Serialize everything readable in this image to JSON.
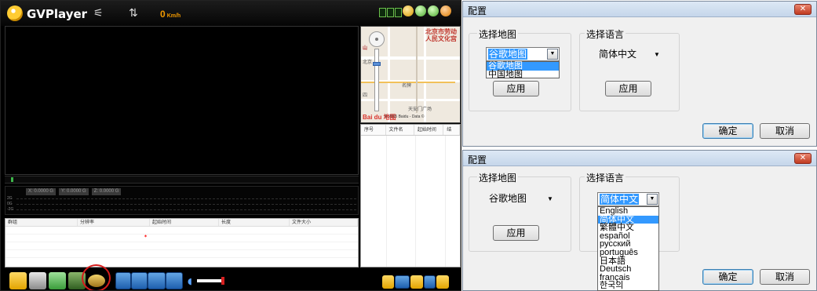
{
  "player": {
    "title": "GVPlayer",
    "speed_value": "0",
    "speed_unit": "Km/h",
    "sensor_readouts": [
      "X: 0.0000 G",
      "Y: 0.0000 G",
      "Z: 0.0000 G"
    ],
    "sensor_axis": [
      "2G",
      "0G",
      "-2G"
    ],
    "event_table_columns": [
      "群组",
      "分辨率",
      "起始时间",
      "长度",
      "文件大小"
    ],
    "file_list_columns": [
      "序号",
      "文件名",
      "起始时间",
      "结"
    ],
    "map": {
      "labels": [
        "北京市劳动",
        "人民文化宫"
      ],
      "small_labels": [
        "山",
        "北京",
        "名牌",
        "天安门广场",
        "四"
      ],
      "brand": "Bai du 地图",
      "copyright": "© 2015 Baidu - Data ©"
    }
  },
  "dialog_top": {
    "title": "配置",
    "map_group_label": "选择地图",
    "map_selected": "谷歌地图",
    "map_options": [
      "谷歌地图",
      "中国地图"
    ],
    "map_highlighted": "谷歌地图",
    "apply_map": "应用",
    "lang_group_label": "选择语言",
    "lang_selected": "简体中文",
    "apply_lang": "应用",
    "ok": "确定",
    "cancel": "取消"
  },
  "dialog_bottom": {
    "title": "配置",
    "map_group_label": "选择地图",
    "map_selected": "谷歌地图",
    "apply_map": "应用",
    "lang_group_label": "选择语言",
    "lang_selected": "简体中文",
    "lang_options": [
      "English",
      "简体中文",
      "繁體中文",
      "español",
      "русский",
      "português",
      "日本語",
      "Deutsch",
      "français",
      "한국의"
    ],
    "lang_highlighted": "简体中文",
    "ok": "确定",
    "cancel": "取消"
  }
}
